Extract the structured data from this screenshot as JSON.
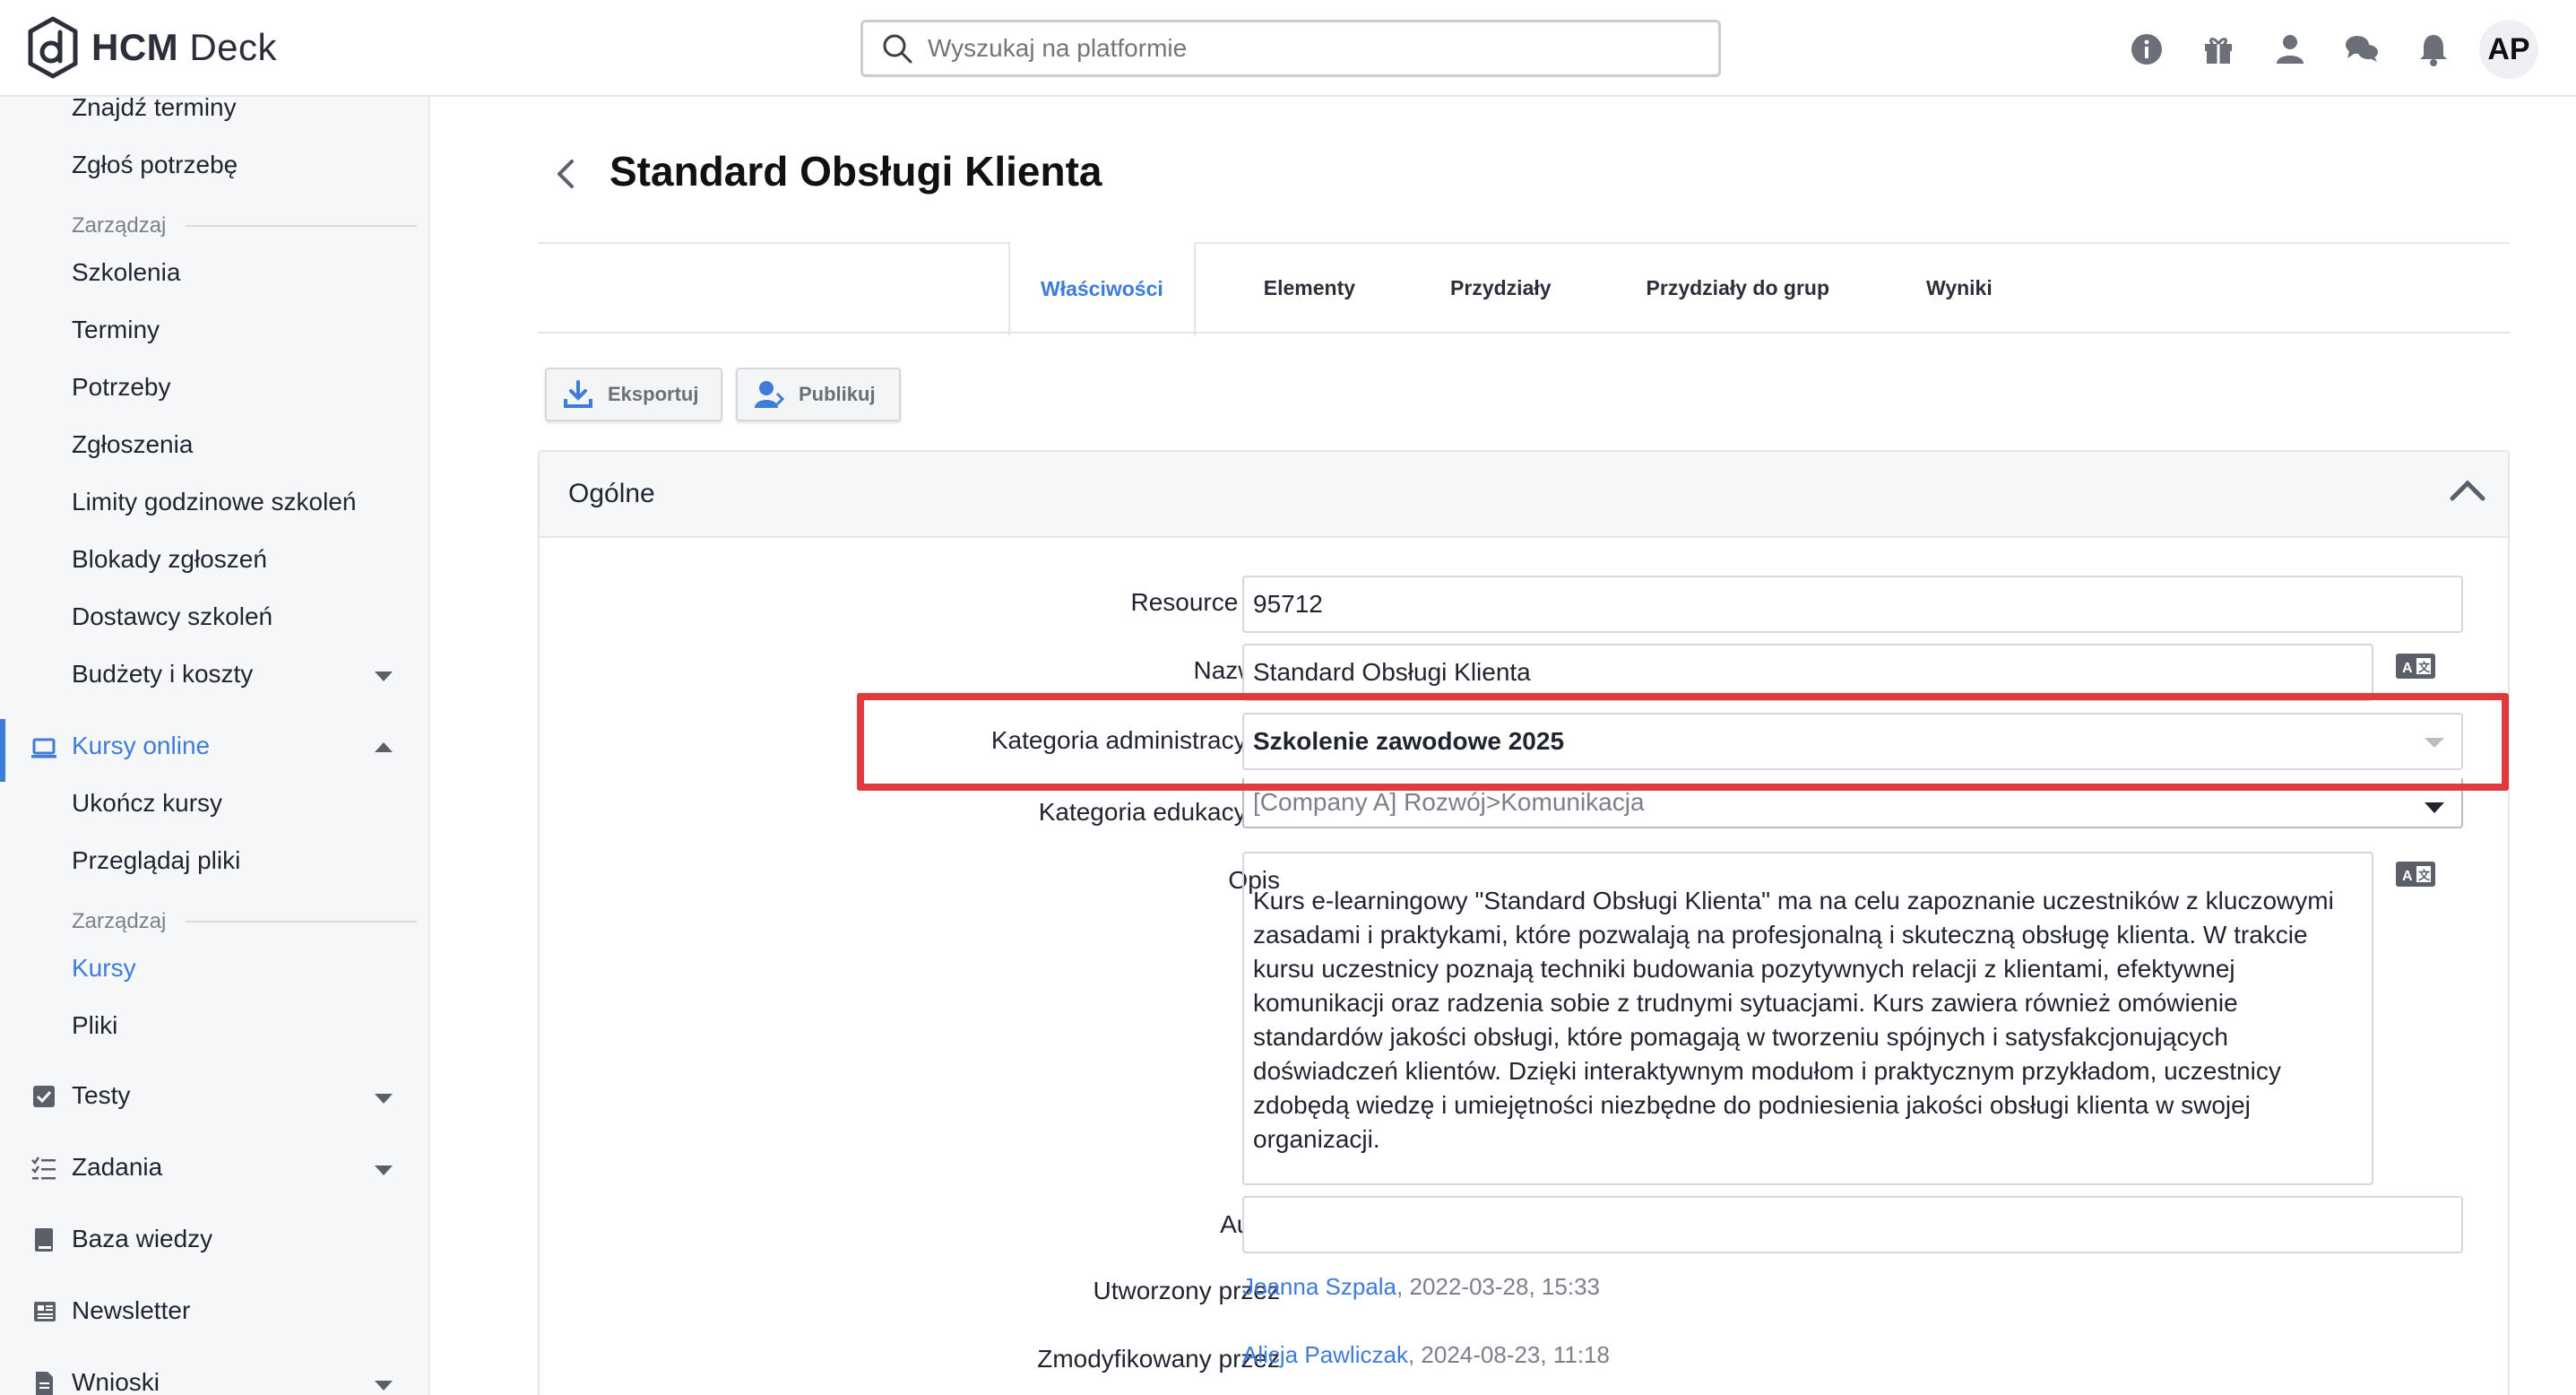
{
  "app": {
    "logo_text_bold": "HCM",
    "logo_text_light": " Deck",
    "search_placeholder": "Wyszukaj na platformie",
    "avatar_initials": "AP",
    "icons": [
      "info-icon",
      "gift-icon",
      "user-icon",
      "chat-icon",
      "bell-icon"
    ]
  },
  "sidebar": {
    "items_top": [
      "Znajdź terminy",
      "Zgłoś potrzebę"
    ],
    "section_manage_1": "Zarządzaj",
    "items_manage_1": [
      "Szkolenia",
      "Terminy",
      "Potrzeby",
      "Zgłoszenia",
      "Limity godzinowe szkoleń",
      "Blokady zgłoszeń",
      "Dostawcy szkoleń",
      "Budżety i koszty"
    ],
    "online_courses": "Kursy online",
    "online_items": [
      "Ukończ kursy",
      "Przeglądaj pliki"
    ],
    "section_manage_2": "Zarządzaj",
    "online_manage_items": [
      "Kursy",
      "Pliki"
    ],
    "tests": "Testy",
    "tasks": "Zadania",
    "knowledge": "Baza wiedzy",
    "newsletter": "Newsletter",
    "requests": "Wnioski"
  },
  "page": {
    "title": "Standard Obsługi Klienta",
    "tabs": [
      "Właściwości",
      "Elementy",
      "Przydziały",
      "Przydziały do grup",
      "Wyniki"
    ],
    "export_label": "Eksportuj",
    "publish_label": "Publikuj",
    "section_title": "Ogólne"
  },
  "form": {
    "resource_id_label": "Resource ID",
    "resource_id_value": "95712",
    "name_label": "Nazwa",
    "name_value": "Standard Obsługi Klienta",
    "admin_category_label": "Kategoria administracyjna",
    "admin_category_value": "Szkolenie zawodowe 2025",
    "edu_category_label": "Kategoria edukacyjna",
    "edu_category_value": "[Company A] Rozwój>Komunikacja",
    "description_label": "Opis",
    "description_value": "Kurs e-learningowy \"Standard Obsługi Klienta\" ma na celu zapoznanie uczestników z kluczowymi zasadami i praktykami, które pozwalają na profesjonalną i skuteczną obsługę klienta. W trakcie kursu uczestnicy poznają techniki budowania pozytywnych relacji z klientami, efektywnej komunikacji oraz radzenia sobie z trudnymi sytuacjami. Kurs zawiera również omówienie standardów jakości obsługi, które pomagają w tworzeniu spójnych i satysfakcjonujących doświadczeń klientów. Dzięki interaktywnym modułom i praktycznym przykładom, uczestnicy zdobędą wiedzę i umiejętności niezbędne do podniesienia jakości obsługi klienta w swojej organizacji.",
    "author_label": "Autor",
    "author_value": "",
    "created_by_label": "Utworzony przez",
    "created_by_name": "Joanna Szpala",
    "created_by_date": ", 2022-03-28, 15:33",
    "modified_by_label": "Zmodyfikowany przez",
    "modified_by_name": "Alicja Pawliczak",
    "modified_by_date": ", 2024-08-23, 11:18"
  },
  "colors": {
    "accent": "#3f7bd8",
    "highlight": "#e0393e",
    "required": "#d6302f"
  }
}
